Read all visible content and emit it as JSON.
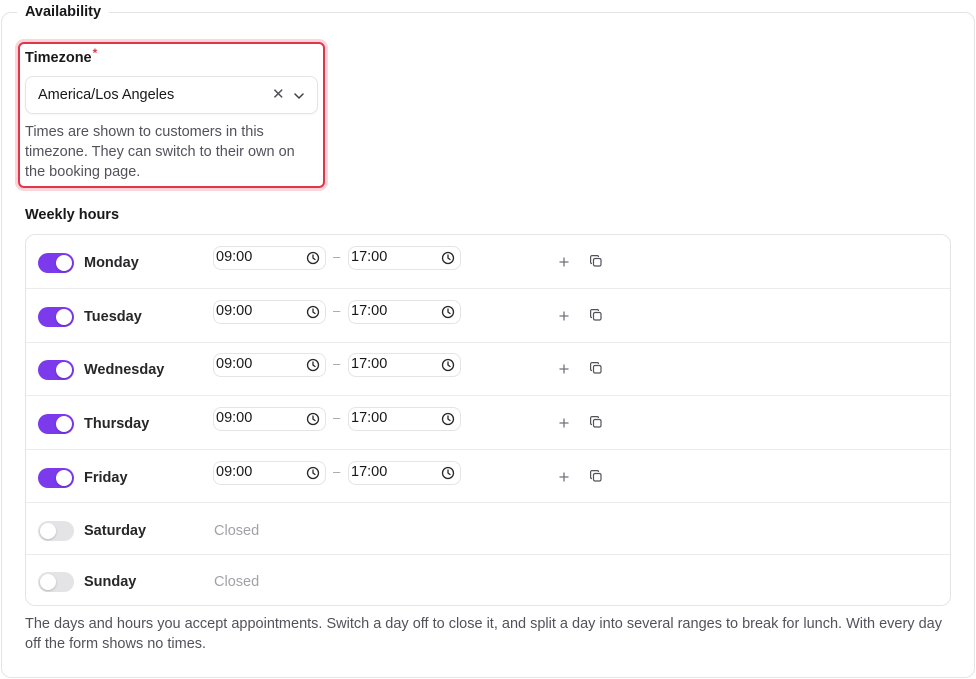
{
  "section": {
    "title": "Availability"
  },
  "timezone": {
    "label": "Timezone",
    "required_mark": "*",
    "value": "America/Los Angeles",
    "clear_glyph": "✕",
    "help": "Times are shown to customers in this timezone. They can switch to their own on the booking page."
  },
  "weekly": {
    "label": "Weekly hours",
    "closed_label": "Closed",
    "dash": "–",
    "days": [
      {
        "name": "Monday",
        "enabled": true,
        "start": "09:00",
        "end": "17:00"
      },
      {
        "name": "Tuesday",
        "enabled": true,
        "start": "09:00",
        "end": "17:00"
      },
      {
        "name": "Wednesday",
        "enabled": true,
        "start": "09:00",
        "end": "17:00"
      },
      {
        "name": "Thursday",
        "enabled": true,
        "start": "09:00",
        "end": "17:00"
      },
      {
        "name": "Friday",
        "enabled": true,
        "start": "09:00",
        "end": "17:00"
      },
      {
        "name": "Saturday",
        "enabled": false,
        "closed": "Closed"
      },
      {
        "name": "Sunday",
        "enabled": false,
        "closed": "Closed"
      }
    ],
    "help": "The days and hours you accept appointments. Switch a day off to close it, and split a day into several ranges to break for lunch. With every day off the form shows no times."
  },
  "icons": {
    "clear": "x-icon",
    "dropdown": "chevron-down-icon",
    "clock": "clock-icon",
    "add": "plus-icon",
    "copy": "copy-icon"
  },
  "colors": {
    "accent": "#7c3aed",
    "error": "#e0364a",
    "toggle_off": "#e4e4e7"
  }
}
